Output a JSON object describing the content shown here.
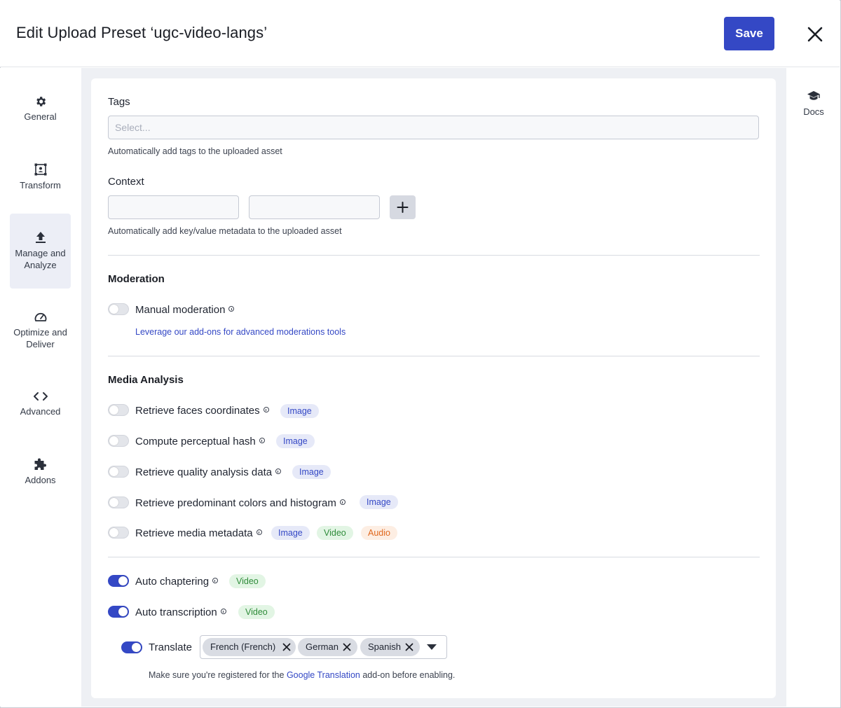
{
  "header": {
    "title": "Edit Upload Preset ‘ugc-video-langs’",
    "save_label": "Save"
  },
  "sidebar": {
    "items": [
      {
        "label": "General",
        "icon": "gear-icon"
      },
      {
        "label": "Transform",
        "icon": "transform-icon"
      },
      {
        "label": "Manage and Analyze",
        "icon": "upload-icon",
        "active": true
      },
      {
        "label": "Optimize and Deliver",
        "icon": "gauge-icon"
      },
      {
        "label": "Advanced",
        "icon": "code-icon"
      },
      {
        "label": "Addons",
        "icon": "puzzle-icon"
      }
    ]
  },
  "right_rail": {
    "docs_label": "Docs",
    "icon": "graduation-cap-icon"
  },
  "tags": {
    "label": "Tags",
    "placeholder": "Select...",
    "help": "Automatically add tags to the uploaded asset"
  },
  "context": {
    "label": "Context",
    "key_value": "",
    "value_value": "",
    "help": "Automatically add key/value metadata to the uploaded asset"
  },
  "moderation": {
    "title": "Moderation",
    "manual_label": "Manual moderation",
    "manual_on": false,
    "link": "Leverage our add-ons for advanced moderations tools"
  },
  "media_analysis": {
    "title": "Media Analysis",
    "rows": [
      {
        "label": "Retrieve faces coordinates",
        "on": false,
        "badges": [
          "Image"
        ]
      },
      {
        "label": "Compute perceptual hash",
        "on": false,
        "badges": [
          "Image"
        ]
      },
      {
        "label": "Retrieve quality analysis data",
        "on": false,
        "badges": [
          "Image"
        ]
      },
      {
        "label": "Retrieve predominant colors and histogram",
        "on": false,
        "badges": [
          "Image"
        ]
      },
      {
        "label": "Retrieve media metadata",
        "on": false,
        "badges": [
          "Image",
          "Video",
          "Audio"
        ]
      }
    ]
  },
  "video_features": {
    "auto_chaptering": {
      "label": "Auto chaptering",
      "on": true,
      "badge": "Video"
    },
    "auto_transcription": {
      "label": "Auto transcription",
      "on": true,
      "badge": "Video"
    },
    "translate": {
      "label": "Translate",
      "on": true,
      "languages": [
        "French (French)",
        "German",
        "Spanish"
      ]
    },
    "note_prefix": "Make sure you're registered for the ",
    "note_link": "Google Translation",
    "note_suffix": " add-on before enabling."
  },
  "colors": {
    "accent": "#3448c5",
    "image_badge_bg": "#e6e9f8",
    "video_badge_bg": "#e2f5e4",
    "audio_badge_bg": "#fdeee3"
  }
}
